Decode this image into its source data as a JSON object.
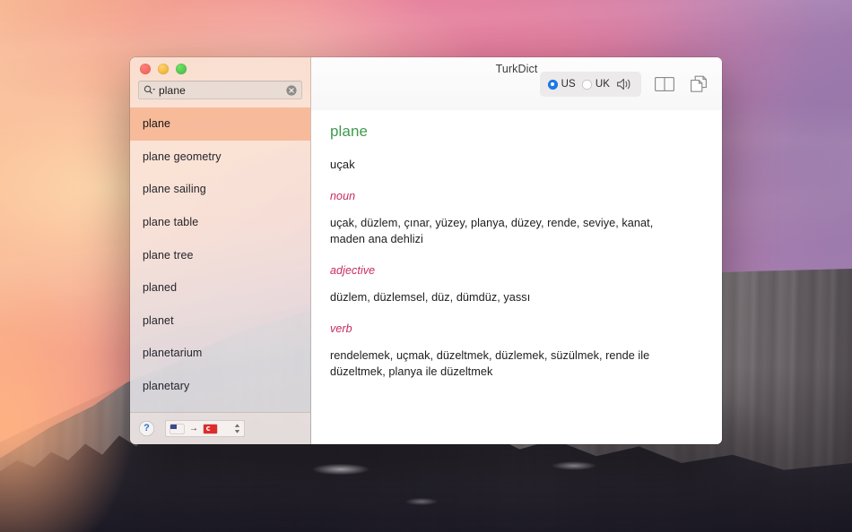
{
  "window": {
    "title": "TurkDict",
    "traffic_lights": [
      {
        "name": "close",
        "color": "#ec5f55"
      },
      {
        "name": "minimize",
        "color": "#e9a920"
      },
      {
        "name": "zoom",
        "color": "#3cb93a"
      }
    ]
  },
  "search": {
    "value": "plane",
    "placeholder": "Search",
    "magnifier_icon": "search-icon",
    "clear_icon": "clear-icon"
  },
  "sidebar": {
    "selected_index": 0,
    "items": [
      {
        "label": "plane"
      },
      {
        "label": "plane geometry"
      },
      {
        "label": "plane sailing"
      },
      {
        "label": "plane table"
      },
      {
        "label": "plane tree"
      },
      {
        "label": "planed"
      },
      {
        "label": "planet"
      },
      {
        "label": "planetarium"
      },
      {
        "label": "planetary"
      }
    ],
    "bottom": {
      "help_label": "?",
      "source_language": "US",
      "target_language": "TR",
      "arrow": "→"
    }
  },
  "toolbar": {
    "accents": [
      {
        "label": "US",
        "selected": true
      },
      {
        "label": "UK",
        "selected": false
      }
    ],
    "speaker_icon": "speaker-icon",
    "book_icon": "book-icon",
    "copy_icon": "copy-icon",
    "accent_color": "#1a7aec"
  },
  "definition": {
    "headword": "plane",
    "headword_color": "#3f9a4e",
    "primary_translation": "uçak",
    "pos_color": "#c82b5e",
    "entries": [
      {
        "pos": "noun",
        "senses": "uçak, düzlem, çınar, yüzey, planya, düzey, rende, seviye, kanat, maden ana dehlizi"
      },
      {
        "pos": "adjective",
        "senses": "düzlem, düzlemsel, düz, dümdüz, yassı"
      },
      {
        "pos": "verb",
        "senses": "rendelemek, uçmak, düzeltmek, düzlemek, süzülmek, rende ile düzeltmek, planya ile düzeltmek"
      }
    ]
  }
}
